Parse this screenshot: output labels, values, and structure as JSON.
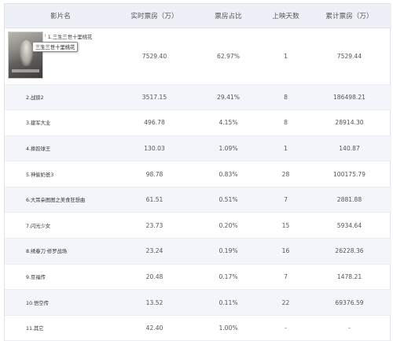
{
  "headers": {
    "name": "影片名",
    "realtime": "实时票房（万）",
    "share": "票房占比",
    "days": "上映天数",
    "cumulative": "累计票房（万）"
  },
  "top": {
    "title": "1.三生三世十里桃花",
    "tooltip": "三生三世十里桃花",
    "realtime": "7529.40",
    "share": "62.97%",
    "days": "1",
    "cumulative": "7529.44"
  },
  "rows": [
    {
      "name": "2.战狼2",
      "realtime": "3517.15",
      "share": "29.41%",
      "days": "8",
      "cumulative": "186498.21"
    },
    {
      "name": "3.建军大业",
      "realtime": "496.78",
      "share": "4.15%",
      "days": "8",
      "cumulative": "28914.30"
    },
    {
      "name": "4.摔跤球王",
      "realtime": "130.03",
      "share": "1.09%",
      "days": "1",
      "cumulative": "140.87"
    },
    {
      "name": "5.神偷奶爸3",
      "realtime": "98.78",
      "share": "0.83%",
      "days": "28",
      "cumulative": "100175.79"
    },
    {
      "name": "6.大耳朵图图之美食狂想曲",
      "realtime": "61.51",
      "share": "0.51%",
      "days": "7",
      "cumulative": "2881.88"
    },
    {
      "name": "7.闪光少女",
      "realtime": "23.73",
      "share": "0.20%",
      "days": "15",
      "cumulative": "5934.64"
    },
    {
      "name": "8.绣春刀·修罗战场",
      "realtime": "23.24",
      "share": "0.19%",
      "days": "16",
      "cumulative": "26228.36"
    },
    {
      "name": "9.豆福传",
      "realtime": "20.48",
      "share": "0.17%",
      "days": "7",
      "cumulative": "1478.21"
    },
    {
      "name": "10.悟空传",
      "realtime": "13.52",
      "share": "0.11%",
      "days": "22",
      "cumulative": "69376.59"
    },
    {
      "name": "11.其它",
      "realtime": "42.40",
      "share": "1.00%",
      "days": "-",
      "cumulative": "-"
    }
  ]
}
